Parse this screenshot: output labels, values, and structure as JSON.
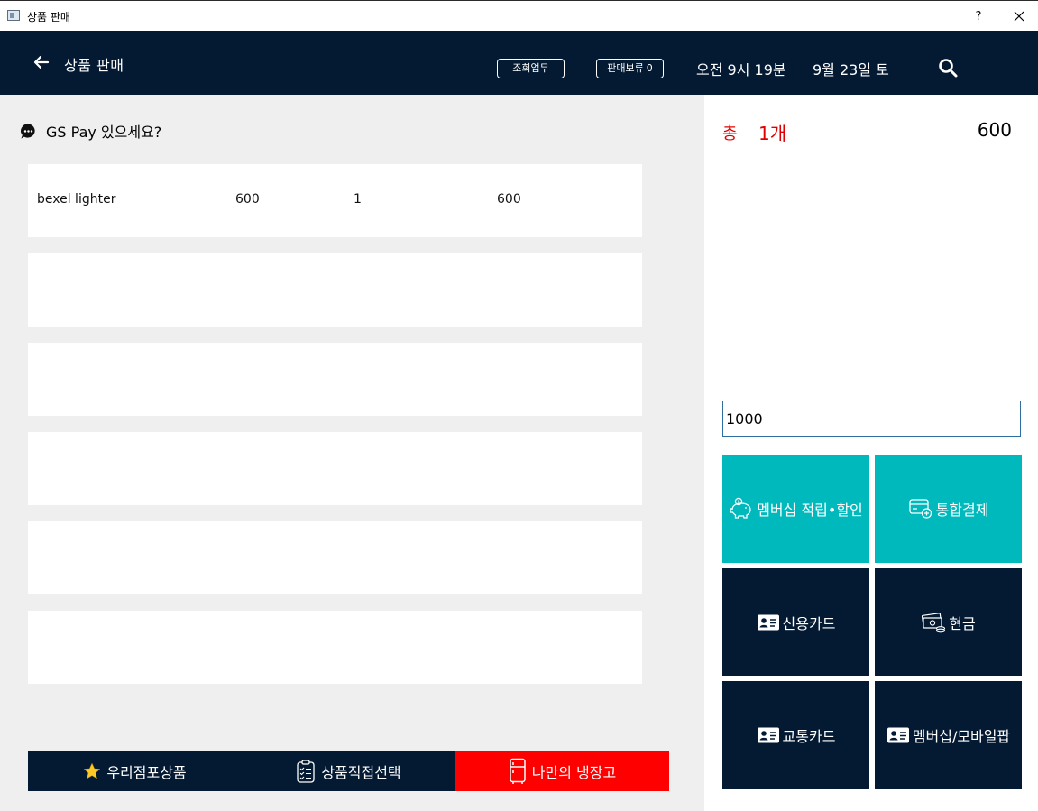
{
  "window": {
    "title": "상품 판매",
    "help_label": "?",
    "close_icon": "close-icon"
  },
  "header": {
    "title": "상품 판매",
    "inquiry_label": "조회업무",
    "hold_label": "판매보류",
    "hold_count": "0",
    "time": "오전 9시 19분",
    "date": "9월 23일 토",
    "icons": {
      "back": "arrow-left-icon",
      "search": "search-icon"
    },
    "bg_color": "#041a33"
  },
  "promo": {
    "text": "GS Pay 있으세요?",
    "icon": "chat-bubble-icon"
  },
  "items": [
    {
      "name": "bexel lighter",
      "price": "600",
      "qty": "1",
      "amount": "600"
    },
    {
      "name": "",
      "price": "",
      "qty": "",
      "amount": ""
    },
    {
      "name": "",
      "price": "",
      "qty": "",
      "amount": ""
    },
    {
      "name": "",
      "price": "",
      "qty": "",
      "amount": ""
    },
    {
      "name": "",
      "price": "",
      "qty": "",
      "amount": ""
    },
    {
      "name": "",
      "price": "",
      "qty": "",
      "amount": ""
    }
  ],
  "bottom_tabs": [
    {
      "label": "우리점포상품",
      "icon": "star-icon",
      "color": "#041a33"
    },
    {
      "label": "상품직접선택",
      "icon": "clipboard-checklist-icon",
      "color": "#041a33"
    },
    {
      "label": "나만의 냉장고",
      "icon": "refrigerator-icon",
      "color": "#ff0000"
    }
  ],
  "summary": {
    "total_label": "총",
    "total_count": "1개",
    "total_amount": "600",
    "accent_color": "#e00000"
  },
  "payment_input": {
    "value": "1000"
  },
  "payment_buttons": [
    {
      "label": "멤버십 적립•할인",
      "icon": "piggy-bank-icon",
      "color": "#00b9bc"
    },
    {
      "label": "통합결제",
      "icon": "card-plus-icon",
      "color": "#00b9bc"
    },
    {
      "label": "신용카드",
      "icon": "id-card-icon",
      "color": "#041a33"
    },
    {
      "label": "현금",
      "icon": "cash-icon",
      "color": "#041a33"
    },
    {
      "label": "교통카드",
      "icon": "id-card-icon",
      "color": "#041a33"
    },
    {
      "label": "멤버십/모바일팝",
      "icon": "id-card-icon",
      "color": "#041a33"
    }
  ]
}
